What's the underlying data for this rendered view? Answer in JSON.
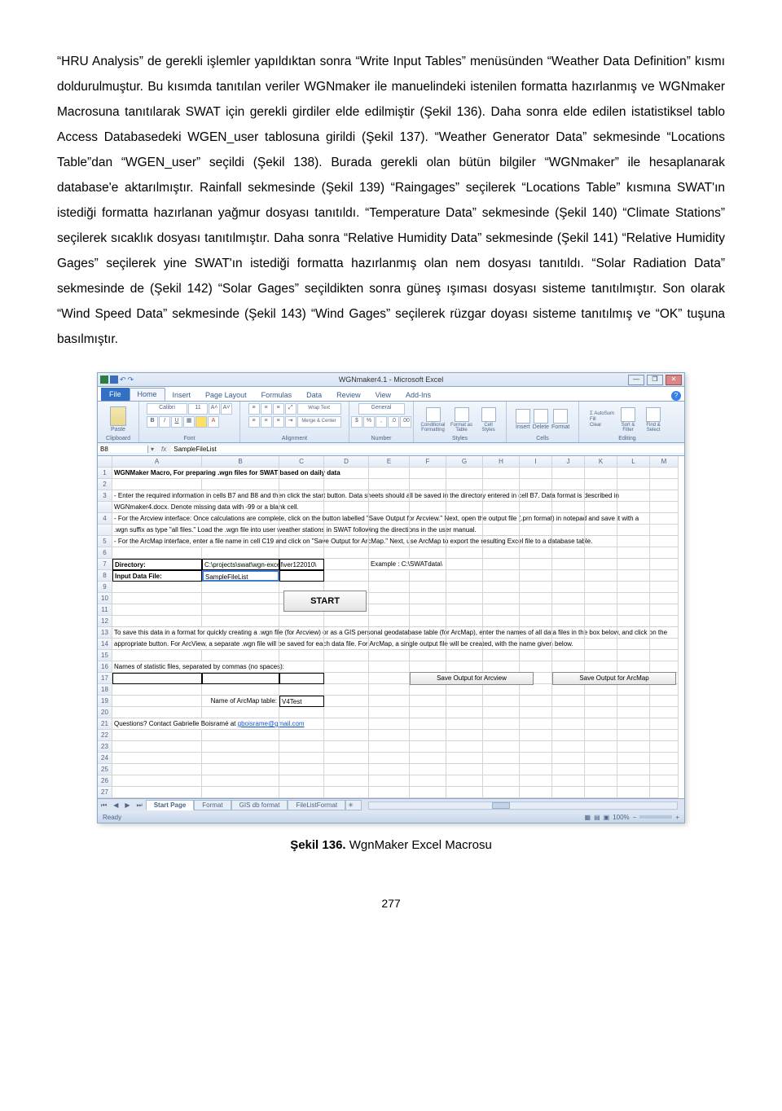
{
  "body_text": "“HRU Analysis” de gerekli işlemler yapıldıktan sonra “Write Input Tables” menüsünden “Weather Data Definition” kısmı doldurulmuştur. Bu kısımda tanıtılan veriler WGNmaker ile manuelindeki istenilen formatta hazırlanmış ve WGNmaker Macrosuna tanıtılarak SWAT için gerekli girdiler elde edilmiştir (Şekil 136). Daha sonra elde edilen istatistiksel tablo Access Databasedeki WGEN_user tablosuna girildi (Şekil 137). “Weather Generator Data” sekmesinde “Locations Table”dan “WGEN_user” seçildi (Şekil 138). Burada gerekli olan bütün bilgiler “WGNmaker” ile hesaplanarak database'e aktarılmıştır. Rainfall sekmesinde (Şekil 139) “Raingages” seçilerek “Locations Table” kısmına SWAT'ın istediği formatta hazırlanan yağmur dosyası tanıtıldı. “Temperature Data” sekmesinde (Şekil 140) “Climate Stations” seçilerek sıcaklık dosyası tanıtılmıştır. Daha sonra “Relative Humidity Data” sekmesinde (Şekil 141) “Relative Humidity Gages” seçilerek yine SWAT'ın istediği formatta hazırlanmış olan nem dosyası tanıtıldı. “Solar Radiation Data” sekmesinde de (Şekil 142) “Solar Gages” seçildikten sonra güneş ışıması dosyası sisteme tanıtılmıştır. Son olarak “Wind Speed Data” sekmesinde (Şekil 143) “Wind Gages” seçilerek rüzgar doyası sisteme tanıtılmış ve “OK” tuşuna basılmıştır.",
  "excel": {
    "title": "WGNmaker4.1 - Microsoft Excel",
    "tabs": [
      "File",
      "Home",
      "Insert",
      "Page Layout",
      "Formulas",
      "Data",
      "Review",
      "View",
      "Add-Ins"
    ],
    "ribbon_groups": [
      "Clipboard",
      "Font",
      "Alignment",
      "Number",
      "Styles",
      "Cells",
      "Editing"
    ],
    "font_name": "Calibri",
    "font_size": "11",
    "wrap": "Wrap Text",
    "merge": "Merge & Center",
    "numfmt": "General",
    "cond": "Conditional Formatting",
    "fmtTable": "Format as Table",
    "cellStyles": "Cell Styles",
    "insert": "Insert",
    "delete": "Delete",
    "format": "Format",
    "autosum": "Σ AutoSum",
    "fill": "Fill",
    "clear": "Clear",
    "sortfind": "Sort & Filter",
    "findsel": "Find & Select",
    "paste": "Paste",
    "namebox": "B8",
    "formula": "SampleFileList",
    "cols": [
      "",
      "A",
      "B",
      "C",
      "D",
      "E",
      "F",
      "G",
      "H",
      "I",
      "J",
      "K",
      "L",
      "M"
    ],
    "rows": {
      "r1": "WGNMaker Macro, For preparing .wgn files for SWAT based on daily data",
      "r3a": "- Enter the required information in cells B7 and B8 and then click the start button.  Data sheets should all be saved in the directory entered in cell B7.  Data format is described in",
      "r3b": "WGNmaker4.docx.  Denote missing data with -99 or a blank cell.",
      "r4": "- For the Arcview interface: Once calculations are complete, click on the button labelled \"Save Output for Arcview.\"  Next, open the output file (.prn format) in notepad and save it with a",
      "r4b": ".wgn suffix as type \"all files.\"  Load the .wgn file into user weather stations in SWAT following the directions in the user manual.",
      "r5": "- For the ArcMap interface, enter a file name in cell C19 and click on \"Save Output for ArcMap.\"  Next, use ArcMap to export the resulting Excel file to a database table.",
      "r7a": "Directory:",
      "r7b": "C:\\projects\\swat\\wgn-excel\\ver122010\\",
      "r7c": "Example : C:\\SWATdata\\",
      "r8a": "Input Data File:",
      "r8b": "SampleFileList",
      "start": "START",
      "r13": "To save this data in a format for quickly creating a .wgn file (for Arcview) or as a GIS personal geodatabase table (for ArcMap), enter the names of all data files in the box below, and click on the",
      "r14": "appropriate button.  For ArcView, a separate .wgn file will be saved for each data file.  For ArcMap, a single output file will be created, with the name given below.",
      "r16": "Names of statistic files, separated by commas (no spaces):",
      "btn1": "Save Output for Arcview",
      "btn2": "Save Output for ArcMap",
      "r19a": "Name of ArcMap table:",
      "r19b": "V4Test",
      "r21": "Questions? Contact Gabrielle Boisramé at ",
      "r21_link": "gboisrame@gmail.com"
    },
    "sheet_tabs": [
      "Start Page",
      "Format",
      "GIS db format",
      "FileListFormat"
    ],
    "status_left": "Ready",
    "status_right": "100%"
  },
  "caption_bold": "Şekil 136.",
  "caption_rest": " WgnMaker Excel Macrosu",
  "pagenum": "277"
}
